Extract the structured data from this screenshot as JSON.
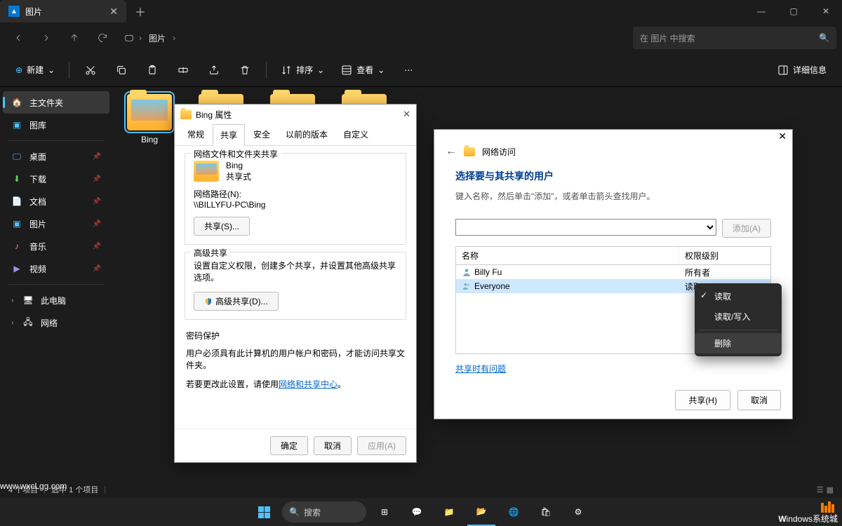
{
  "titlebar": {
    "tab_label": "图片"
  },
  "nav": {
    "breadcrumb": [
      "图片"
    ],
    "search_placeholder": "在 图片 中搜索"
  },
  "toolbar": {
    "new": "新建",
    "sort": "排序",
    "view": "查看",
    "details": "详细信息"
  },
  "sidebar": {
    "home": "主文件夹",
    "gallery": "图库",
    "desktop": "桌面",
    "downloads": "下载",
    "documents": "文档",
    "pictures": "图片",
    "music": "音乐",
    "videos": "视频",
    "thispc": "此电脑",
    "network": "网络"
  },
  "content": {
    "folders": [
      {
        "name": "Bing",
        "selected": true,
        "thumb": true
      },
      {
        "name": "",
        "selected": false,
        "thumb": false
      },
      {
        "name": "",
        "selected": false,
        "thumb": false
      },
      {
        "name": "",
        "selected": false,
        "thumb": false
      }
    ]
  },
  "statusbar": {
    "count": "4 个项目",
    "selected": "选中 1 个项目"
  },
  "properties_dialog": {
    "title": "Bing 属性",
    "tabs": [
      "常规",
      "共享",
      "安全",
      "以前的版本",
      "自定义"
    ],
    "active_tab": 1,
    "section_net": {
      "title": "网络文件和文件夹共享",
      "folder_name": "Bing",
      "status": "共享式",
      "path_label": "网络路径(N):",
      "path_value": "\\\\BILLYFU-PC\\Bing",
      "share_button": "共享(S)..."
    },
    "section_adv": {
      "title": "高级共享",
      "desc": "设置自定义权限，创建多个共享，并设置其他高级共享选项。",
      "button": "高级共享(D)..."
    },
    "section_pwd": {
      "title": "密码保护",
      "line1": "用户必须具有此计算机的用户帐户和密码，才能访问共享文件夹。",
      "line2_a": "若要更改此设置，请使用",
      "line2_link": "网络和共享中心",
      "line2_b": "。"
    },
    "footer": {
      "ok": "确定",
      "cancel": "取消",
      "apply": "应用(A)"
    }
  },
  "network_dialog": {
    "title": "网络访问",
    "heading": "选择要与其共享的用户",
    "hint": "键入名称，然后单击\"添加\"，或者单击箭头查找用户。",
    "add_button": "添加(A)",
    "columns": {
      "name": "名称",
      "perm": "权限级别"
    },
    "rows": [
      {
        "name": "Billy Fu",
        "perm": "所有者",
        "selected": false
      },
      {
        "name": "Everyone",
        "perm": "读取",
        "selected": true,
        "dropdown": true
      }
    ],
    "trouble_link": "共享时有问题",
    "footer": {
      "share": "共享(H)",
      "cancel": "取消"
    }
  },
  "context_menu": {
    "items": [
      {
        "label": "读取",
        "checked": true
      },
      {
        "label": "读取/写入",
        "checked": false
      }
    ],
    "remove": "删除"
  },
  "taskbar": {
    "search": "搜索"
  },
  "watermark": {
    "brand_a": "W",
    "brand_b": "indows系统城",
    "url": "www.wxcLgg.com"
  }
}
